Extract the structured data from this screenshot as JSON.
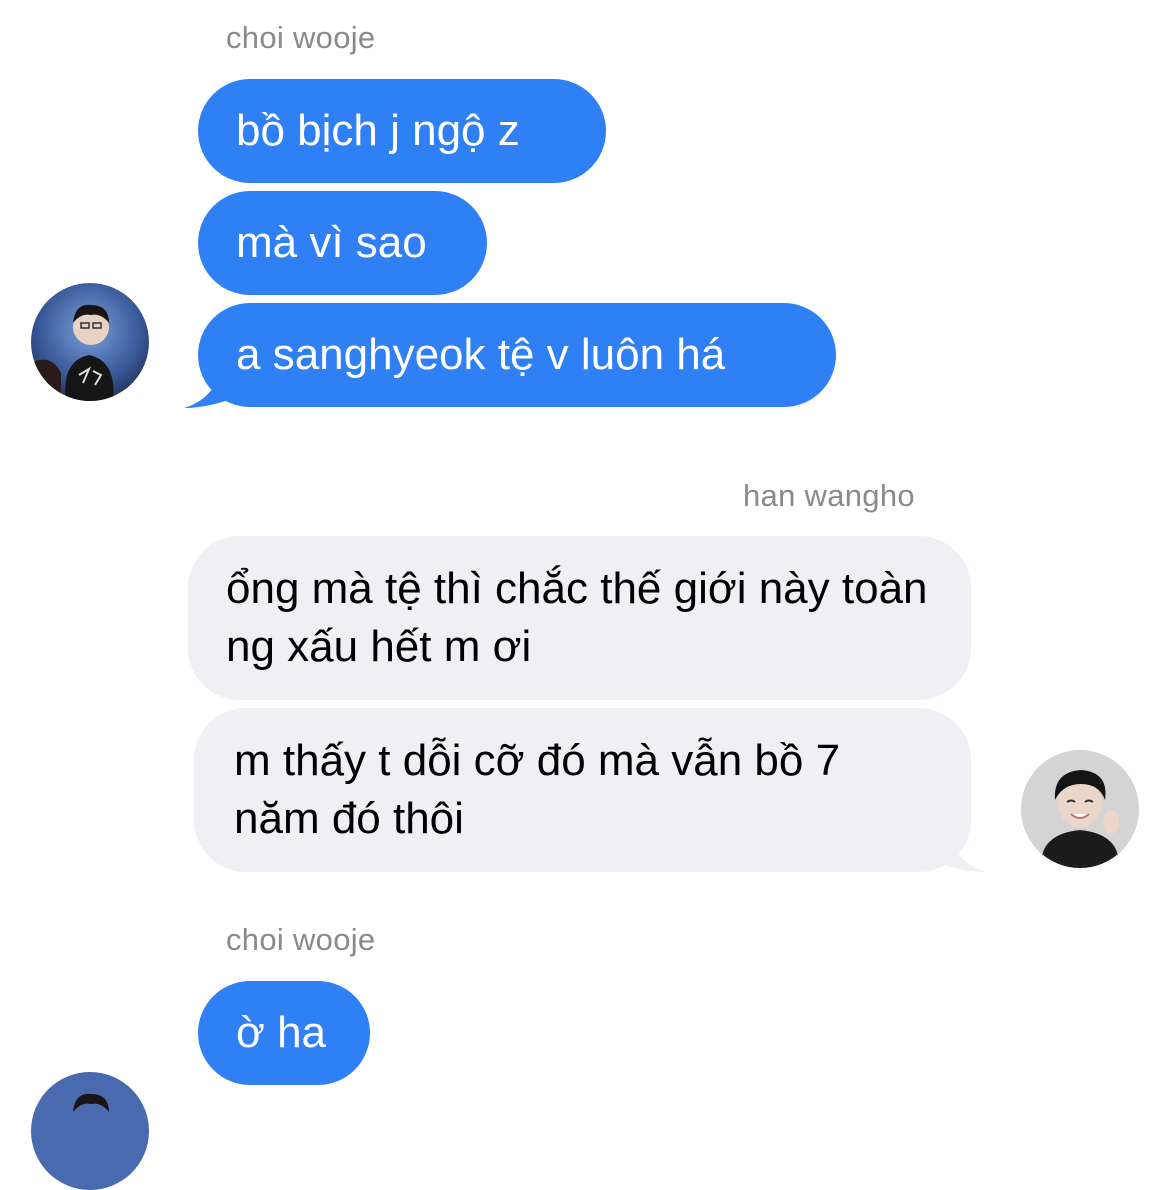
{
  "conversation": {
    "group1": {
      "sender": "choi wooje",
      "messages": [
        "bồ bịch j ngộ z",
        "mà vì sao",
        "a sanghyeok tệ v luôn há"
      ]
    },
    "group2": {
      "sender": "han wangho",
      "messages": [
        "ổng mà tệ thì chắc thế giới này toàn ng xấu hết m ơi",
        "m thấy t dỗi cỡ đó mà vẫn bồ 7 năm đó thôi"
      ]
    },
    "group3": {
      "sender": "choi wooje",
      "messages": [
        "ờ ha"
      ]
    }
  },
  "colors": {
    "blue_bubble": "#2f7ff5",
    "gray_bubble": "#efeff4",
    "sender_name": "#8a8a8e"
  },
  "icons": [
    "avatar-choi-wooje",
    "avatar-han-wangho"
  ]
}
